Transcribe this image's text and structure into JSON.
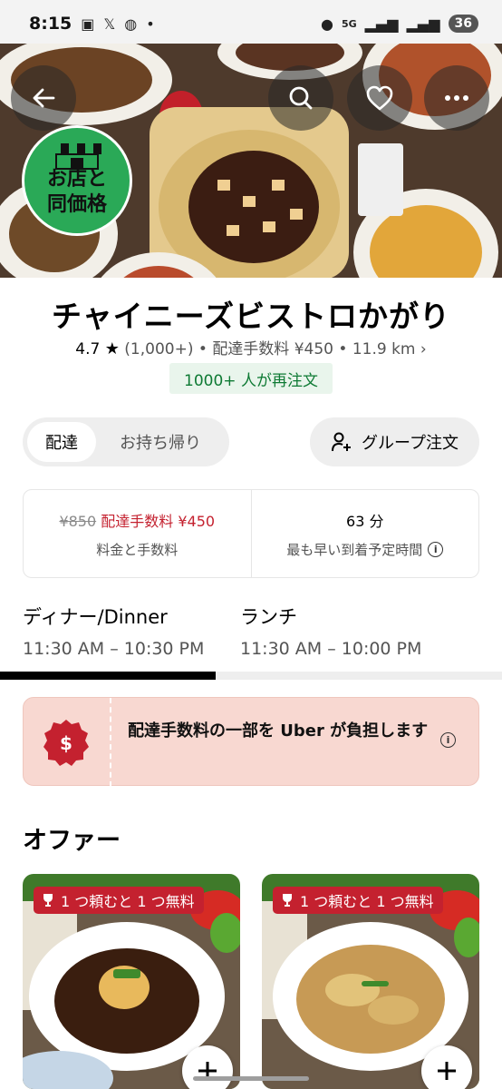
{
  "status_bar": {
    "time": "8:15",
    "network": "5G",
    "battery": "36"
  },
  "hero": {
    "promo_badge_line1": "お店と",
    "promo_badge_line2": "同価格"
  },
  "store": {
    "name": "チャイニーズビストロかがり",
    "rating": "4.7",
    "reviews": "(1,000+)",
    "delivery_fee_meta": "配達手数料 ¥450",
    "distance": "11.9 km",
    "reorder_chip": "1000+ 人が再注文"
  },
  "toggle": {
    "delivery": "配達",
    "pickup": "お持ち帰り"
  },
  "group_order": {
    "label": "グループ注文"
  },
  "fees": {
    "original": "¥850",
    "current": "配達手数料 ¥450",
    "fees_label": "料金と手数料",
    "eta": "63 分",
    "eta_label": "最も早い到着予定時間"
  },
  "hours": [
    {
      "label": "ディナー/Dinner",
      "time": "11:30 AM – 10:30 PM"
    },
    {
      "label": "ランチ",
      "time": "11:30 AM – 10:00 PM"
    }
  ],
  "tab_progress": 0.43,
  "uber_banner": {
    "text": "配達手数料の一部を Uber が負担します"
  },
  "offers": {
    "title": "オファー",
    "items": [
      {
        "badge": "1 つ頼むと 1 つ無料"
      },
      {
        "badge": "1 つ頼むと 1 つ無料"
      }
    ]
  },
  "colors": {
    "accent_red": "#c4212f",
    "green": "#0e7a34",
    "banner_bg": "#f8d8d1"
  }
}
